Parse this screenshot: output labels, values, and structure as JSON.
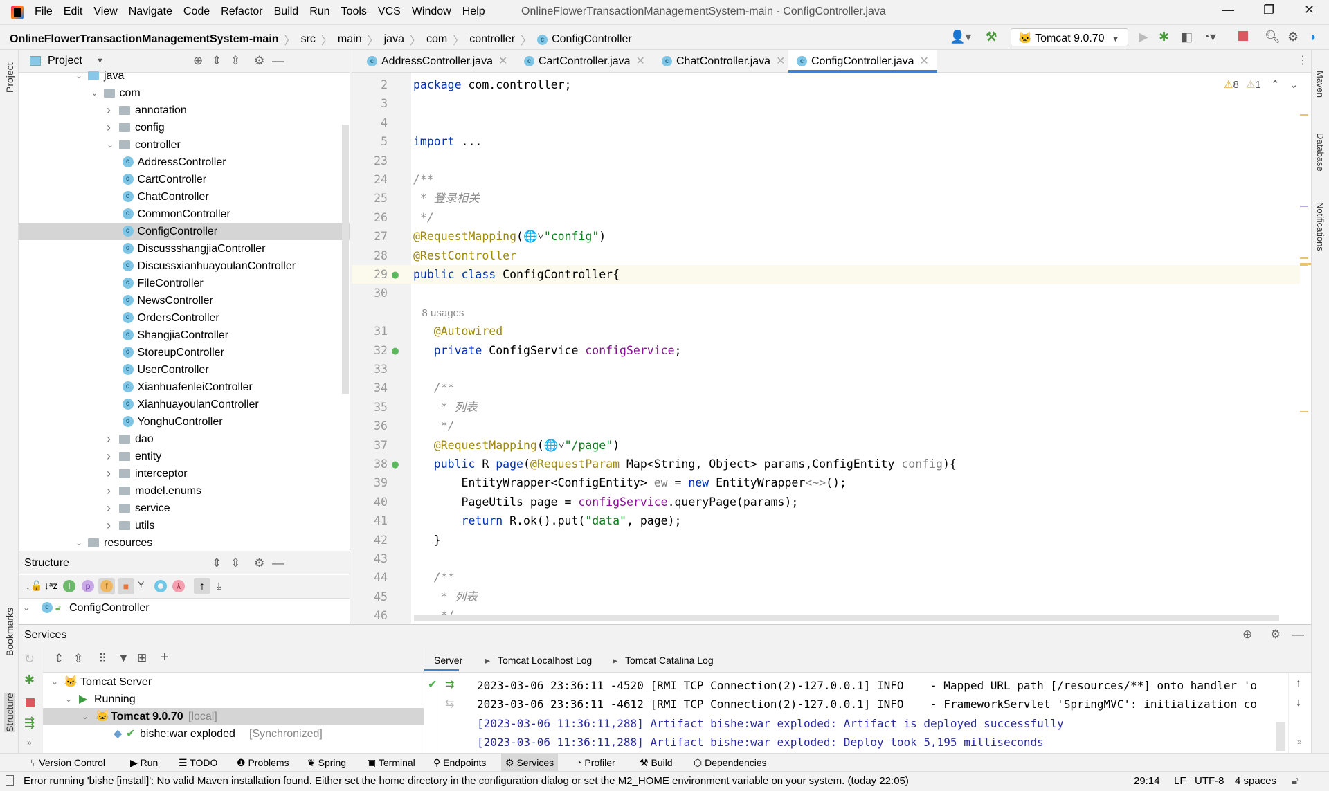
{
  "window": {
    "title": "OnlineFlowerTransactionManagementSystem-main - ConfigController.java",
    "menu": [
      "File",
      "Edit",
      "View",
      "Navigate",
      "Code",
      "Refactor",
      "Build",
      "Run",
      "Tools",
      "VCS",
      "Window",
      "Help"
    ]
  },
  "nav": {
    "breadcrumb": [
      "OnlineFlowerTransactionManagementSystem-main",
      "src",
      "main",
      "java",
      "com",
      "controller",
      "ConfigController"
    ],
    "run_config": "Tomcat 9.0.70"
  },
  "left_strip": [
    "Project",
    "Bookmarks",
    "Structure"
  ],
  "right_strip": [
    "Maven",
    "Database",
    "Notifications"
  ],
  "project": {
    "title": "Project",
    "tree": [
      {
        "label": "java",
        "level": 0,
        "type": "src",
        "open": true
      },
      {
        "label": "com",
        "level": 1,
        "type": "folder",
        "open": true
      },
      {
        "label": "annotation",
        "level": 2,
        "type": "folder",
        "open": false
      },
      {
        "label": "config",
        "level": 2,
        "type": "folder",
        "open": false
      },
      {
        "label": "controller",
        "level": 2,
        "type": "folder",
        "open": true
      },
      {
        "label": "AddressController",
        "level": 3,
        "type": "class"
      },
      {
        "label": "CartController",
        "level": 3,
        "type": "class"
      },
      {
        "label": "ChatController",
        "level": 3,
        "type": "class"
      },
      {
        "label": "CommonController",
        "level": 3,
        "type": "class"
      },
      {
        "label": "ConfigController",
        "level": 3,
        "type": "class",
        "selected": true
      },
      {
        "label": "DiscussshangjiaController",
        "level": 3,
        "type": "class"
      },
      {
        "label": "DiscussxianhuayoulanController",
        "level": 3,
        "type": "class"
      },
      {
        "label": "FileController",
        "level": 3,
        "type": "class"
      },
      {
        "label": "NewsController",
        "level": 3,
        "type": "class"
      },
      {
        "label": "OrdersController",
        "level": 3,
        "type": "class"
      },
      {
        "label": "ShangjiaController",
        "level": 3,
        "type": "class"
      },
      {
        "label": "StoreupController",
        "level": 3,
        "type": "class"
      },
      {
        "label": "UserController",
        "level": 3,
        "type": "class"
      },
      {
        "label": "XianhuafenleiController",
        "level": 3,
        "type": "class"
      },
      {
        "label": "XianhuayoulanController",
        "level": 3,
        "type": "class"
      },
      {
        "label": "YonghuController",
        "level": 3,
        "type": "class"
      },
      {
        "label": "dao",
        "level": 2,
        "type": "folder",
        "open": false
      },
      {
        "label": "entity",
        "level": 2,
        "type": "folder",
        "open": false
      },
      {
        "label": "interceptor",
        "level": 2,
        "type": "folder",
        "open": false
      },
      {
        "label": "model.enums",
        "level": 2,
        "type": "folder",
        "open": false
      },
      {
        "label": "service",
        "level": 2,
        "type": "folder",
        "open": false
      },
      {
        "label": "utils",
        "level": 2,
        "type": "folder",
        "open": false
      },
      {
        "label": "resources",
        "level": 0,
        "type": "res",
        "open": true
      }
    ]
  },
  "structure": {
    "title": "Structure",
    "root": "ConfigController"
  },
  "editor": {
    "tabs": [
      {
        "label": "AddressController.java"
      },
      {
        "label": "CartController.java"
      },
      {
        "label": "ChatController.java"
      },
      {
        "label": "ConfigController.java",
        "active": true
      }
    ],
    "warnings": "8",
    "weak_warnings": "1",
    "lines": [
      {
        "n": "2",
        "t": [
          [
            "k",
            "package "
          ],
          [
            "",
            "com.controller;"
          ]
        ]
      },
      {
        "n": "3",
        "t": []
      },
      {
        "n": "4",
        "t": []
      },
      {
        "n": "5",
        "t": [
          [
            "k",
            "import "
          ],
          [
            "",
            "..."
          ]
        ]
      },
      {
        "n": "23",
        "t": []
      },
      {
        "n": "24",
        "t": [
          [
            "c",
            "/**"
          ]
        ]
      },
      {
        "n": "25",
        "t": [
          [
            "c",
            " * 登录相关"
          ]
        ]
      },
      {
        "n": "26",
        "t": [
          [
            "c",
            " */"
          ]
        ]
      },
      {
        "n": "27",
        "t": [
          [
            "a",
            "@RequestMapping"
          ],
          [
            "",
            "(🌐˅"
          ],
          [
            "s",
            "\"config\""
          ],
          [
            "",
            ")"
          ]
        ]
      },
      {
        "n": "28",
        "t": [
          [
            "a",
            "@RestController"
          ]
        ]
      },
      {
        "n": "29",
        "cur": true,
        "t": [
          [
            "k",
            "public class "
          ],
          [
            "",
            "ConfigController{"
          ]
        ]
      },
      {
        "n": "30",
        "t": []
      },
      {
        "n": "",
        "t": [
          [
            "u",
            "   8 usages"
          ]
        ]
      },
      {
        "n": "31",
        "t": [
          [
            "a",
            "   @Autowired"
          ]
        ]
      },
      {
        "n": "32",
        "t": [
          [
            "k",
            "   private "
          ],
          [
            "",
            "ConfigService "
          ],
          [
            "f",
            "configService"
          ],
          [
            "",
            ";"
          ]
        ]
      },
      {
        "n": "33",
        "t": []
      },
      {
        "n": "34",
        "t": [
          [
            "c",
            "   /**"
          ]
        ]
      },
      {
        "n": "35",
        "t": [
          [
            "c",
            "    * 列表"
          ]
        ]
      },
      {
        "n": "36",
        "t": [
          [
            "c",
            "    */"
          ]
        ]
      },
      {
        "n": "37",
        "t": [
          [
            "a",
            "   @RequestMapping"
          ],
          [
            "",
            "(🌐˅"
          ],
          [
            "s",
            "\"/page\""
          ],
          [
            "",
            ")"
          ]
        ]
      },
      {
        "n": "38",
        "t": [
          [
            "k",
            "   public "
          ],
          [
            "",
            "R "
          ],
          [
            "k",
            "page"
          ],
          [
            "",
            "("
          ],
          [
            "a",
            "@RequestParam "
          ],
          [
            "",
            "Map<String, Object> params,ConfigEntity "
          ],
          [
            "g",
            "config"
          ],
          [
            "",
            "){"
          ]
        ]
      },
      {
        "n": "39",
        "t": [
          [
            "",
            "       EntityWrapper<ConfigEntity> "
          ],
          [
            "g",
            "ew"
          ],
          [
            "",
            " = "
          ],
          [
            "k",
            "new "
          ],
          [
            "",
            "EntityWrapper"
          ],
          [
            "g",
            "<~>"
          ],
          [
            "",
            "();"
          ]
        ]
      },
      {
        "n": "40",
        "t": [
          [
            "",
            "       PageUtils page = "
          ],
          [
            "f",
            "configService"
          ],
          [
            "",
            ".queryPage(params);"
          ]
        ]
      },
      {
        "n": "41",
        "t": [
          [
            "k",
            "       return "
          ],
          [
            "",
            "R.ok().put("
          ],
          [
            "s",
            "\"data\""
          ],
          [
            "",
            ", page);"
          ]
        ]
      },
      {
        "n": "42",
        "t": [
          [
            "",
            "   }"
          ]
        ]
      },
      {
        "n": "43",
        "t": []
      },
      {
        "n": "44",
        "t": [
          [
            "c",
            "   /**"
          ]
        ]
      },
      {
        "n": "45",
        "t": [
          [
            "c",
            "    * 列表"
          ]
        ]
      },
      {
        "n": "46",
        "t": [
          [
            "c",
            "    */"
          ]
        ]
      }
    ]
  },
  "services": {
    "title": "Services",
    "tree": [
      {
        "label": "Tomcat Server",
        "suffix": ""
      },
      {
        "label": "Running",
        "suffix": ""
      },
      {
        "label": "Tomcat 9.0.70",
        "suffix": "[local]"
      },
      {
        "label": "bishe:war exploded",
        "suffix": "[Synchronized]"
      }
    ],
    "console_tabs": [
      "Server",
      "Tomcat Localhost Log",
      "Tomcat Catalina Log"
    ],
    "log": [
      "2023-03-06 23:36:11 -4520 [RMI TCP Connection(2)-127.0.0.1] INFO    - Mapped URL path [/resources/**] onto handler 'o",
      "2023-03-06 23:36:11 -4612 [RMI TCP Connection(2)-127.0.0.1] INFO    - FrameworkServlet 'SpringMVC': initialization co",
      "[2023-03-06 11:36:11,288] Artifact bishe:war exploded: Artifact is deployed successfully",
      "[2023-03-06 11:36:11,288] Artifact bishe:war exploded: Deploy took 5,195 milliseconds"
    ]
  },
  "tool_windows": [
    "Version Control",
    "Run",
    "TODO",
    "Problems",
    "Spring",
    "Terminal",
    "Endpoints",
    "Services",
    "Profiler",
    "Build",
    "Dependencies"
  ],
  "status": {
    "message": "Error running 'bishe [install]': No valid Maven installation found. Either set the home directory in the configuration dialog or set the M2_HOME environment variable on your system. (today 22:05)",
    "position": "29:14",
    "line_sep": "LF",
    "encoding": "UTF-8",
    "indent": "4 spaces"
  }
}
